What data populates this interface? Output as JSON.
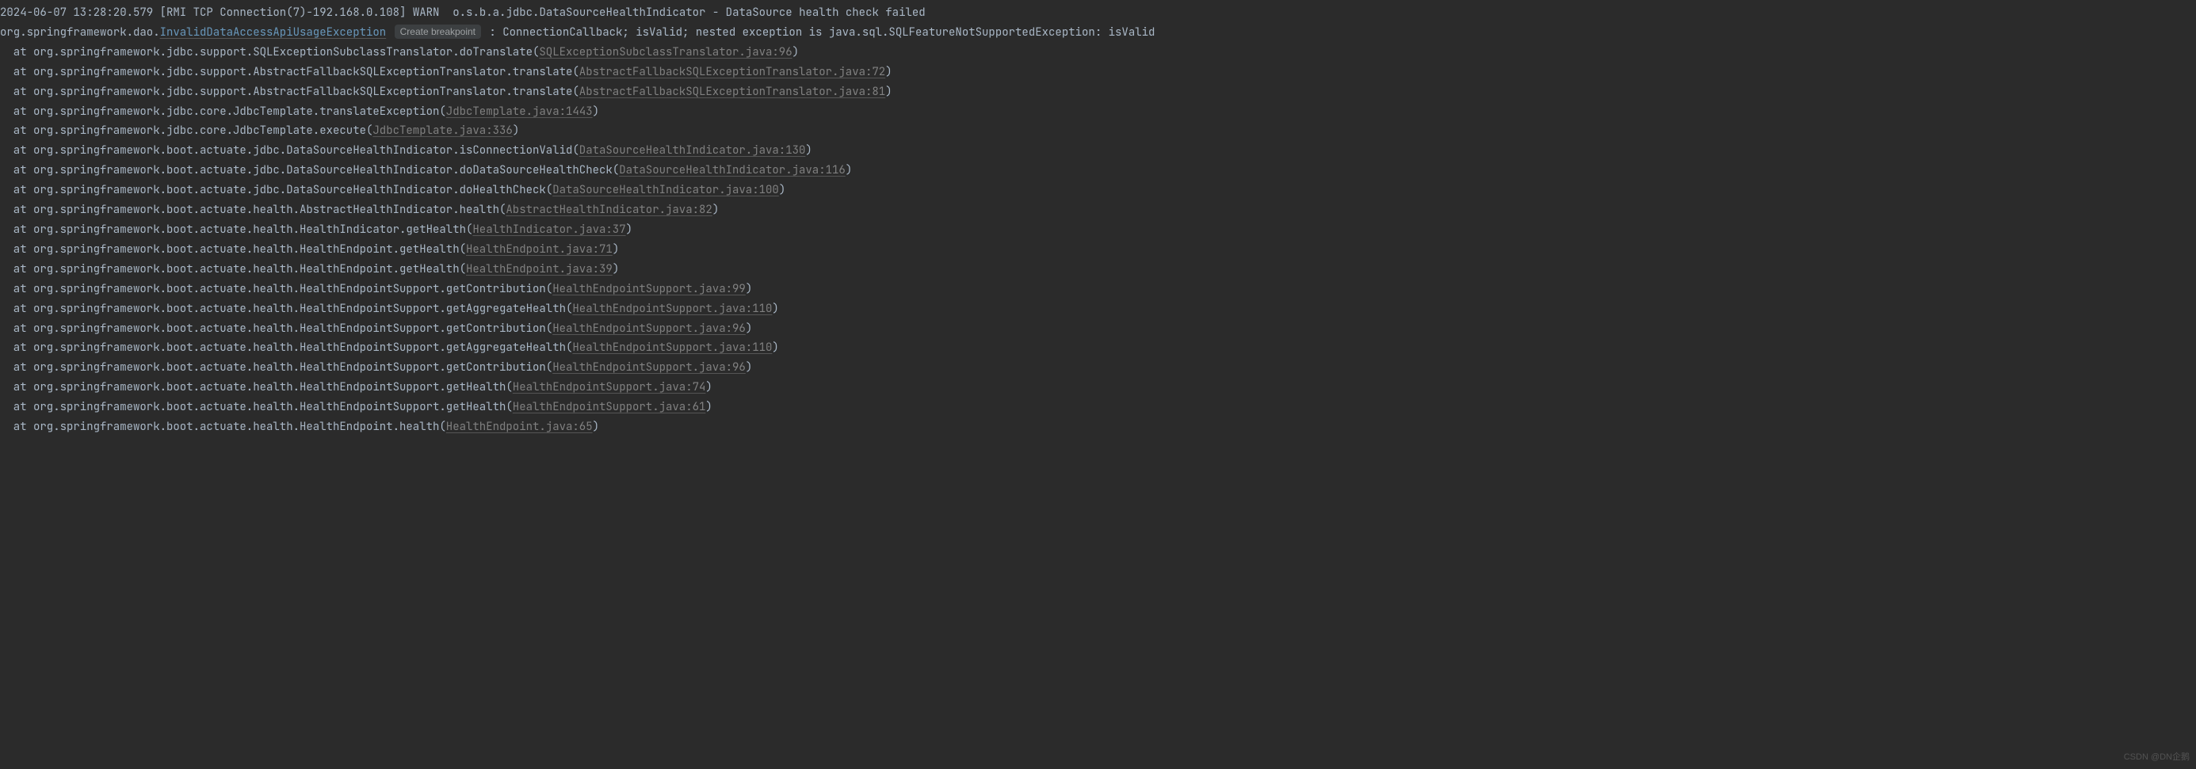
{
  "header": {
    "timestamp": "2024-06-07 13:28:20.579",
    "thread": "[RMI TCP Connection(7)-192.168.0.108]",
    "level": "WARN",
    "logger": "o.s.b.a.jdbc.DataSourceHealthIndicator",
    "sep": "-",
    "msg": "DataSource health check failed"
  },
  "exception": {
    "pkg": "org.springframework.dao.",
    "cls": "InvalidDataAccessApiUsageException",
    "breakpoint_label": "Create breakpoint",
    "tail": ": ConnectionCallback; isValid; nested exception is java.sql.SQLFeatureNotSupportedException: isValid"
  },
  "stack": [
    {
      "pre": "at org.springframework.jdbc.support.SQLExceptionSubclassTranslator.doTranslate(",
      "link": "SQLExceptionSubclassTranslator.java:96",
      "post": ")"
    },
    {
      "pre": "at org.springframework.jdbc.support.AbstractFallbackSQLExceptionTranslator.translate(",
      "link": "AbstractFallbackSQLExceptionTranslator.java:72",
      "post": ")"
    },
    {
      "pre": "at org.springframework.jdbc.support.AbstractFallbackSQLExceptionTranslator.translate(",
      "link": "AbstractFallbackSQLExceptionTranslator.java:81",
      "post": ")"
    },
    {
      "pre": "at org.springframework.jdbc.core.JdbcTemplate.translateException(",
      "link": "JdbcTemplate.java:1443",
      "post": ")"
    },
    {
      "pre": "at org.springframework.jdbc.core.JdbcTemplate.execute(",
      "link": "JdbcTemplate.java:336",
      "post": ")"
    },
    {
      "pre": "at org.springframework.boot.actuate.jdbc.DataSourceHealthIndicator.isConnectionValid(",
      "link": "DataSourceHealthIndicator.java:130",
      "post": ")"
    },
    {
      "pre": "at org.springframework.boot.actuate.jdbc.DataSourceHealthIndicator.doDataSourceHealthCheck(",
      "link": "DataSourceHealthIndicator.java:116",
      "post": ")"
    },
    {
      "pre": "at org.springframework.boot.actuate.jdbc.DataSourceHealthIndicator.doHealthCheck(",
      "link": "DataSourceHealthIndicator.java:100",
      "post": ")"
    },
    {
      "pre": "at org.springframework.boot.actuate.health.AbstractHealthIndicator.health(",
      "link": "AbstractHealthIndicator.java:82",
      "post": ")"
    },
    {
      "pre": "at org.springframework.boot.actuate.health.HealthIndicator.getHealth(",
      "link": "HealthIndicator.java:37",
      "post": ")"
    },
    {
      "pre": "at org.springframework.boot.actuate.health.HealthEndpoint.getHealth(",
      "link": "HealthEndpoint.java:71",
      "post": ")"
    },
    {
      "pre": "at org.springframework.boot.actuate.health.HealthEndpoint.getHealth(",
      "link": "HealthEndpoint.java:39",
      "post": ")"
    },
    {
      "pre": "at org.springframework.boot.actuate.health.HealthEndpointSupport.getContribution(",
      "link": "HealthEndpointSupport.java:99",
      "post": ")"
    },
    {
      "pre": "at org.springframework.boot.actuate.health.HealthEndpointSupport.getAggregateHealth(",
      "link": "HealthEndpointSupport.java:110",
      "post": ")"
    },
    {
      "pre": "at org.springframework.boot.actuate.health.HealthEndpointSupport.getContribution(",
      "link": "HealthEndpointSupport.java:96",
      "post": ")"
    },
    {
      "pre": "at org.springframework.boot.actuate.health.HealthEndpointSupport.getAggregateHealth(",
      "link": "HealthEndpointSupport.java:110",
      "post": ")"
    },
    {
      "pre": "at org.springframework.boot.actuate.health.HealthEndpointSupport.getContribution(",
      "link": "HealthEndpointSupport.java:96",
      "post": ")"
    },
    {
      "pre": "at org.springframework.boot.actuate.health.HealthEndpointSupport.getHealth(",
      "link": "HealthEndpointSupport.java:74",
      "post": ")"
    },
    {
      "pre": "at org.springframework.boot.actuate.health.HealthEndpointSupport.getHealth(",
      "link": "HealthEndpointSupport.java:61",
      "post": ")"
    },
    {
      "pre": "at org.springframework.boot.actuate.health.HealthEndpoint.health(",
      "link": "HealthEndpoint.java:65",
      "post": ")"
    }
  ],
  "watermark": "CSDN @DN企鹅"
}
